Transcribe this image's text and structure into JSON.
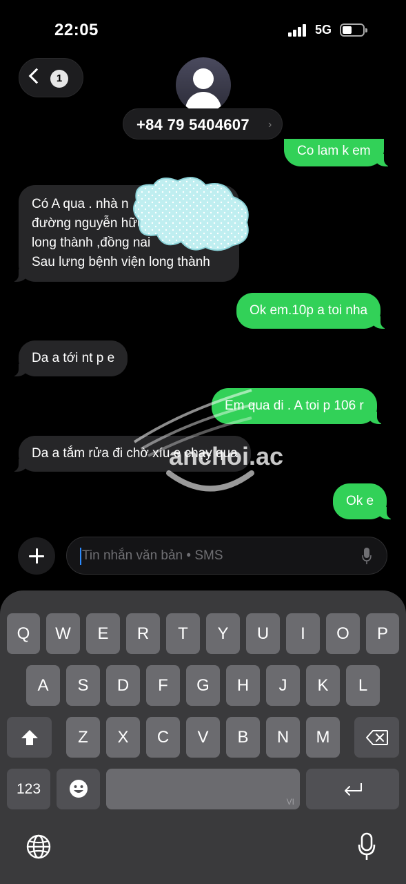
{
  "status_bar": {
    "time": "22:05",
    "network": "5G",
    "icons": [
      "signal-icon",
      "battery-icon"
    ]
  },
  "header": {
    "back_badge": "1",
    "contact": "+84 79 5404607",
    "icons": [
      "chevron-left-icon",
      "avatar-icon",
      "chevron-right-icon"
    ]
  },
  "messages": [
    {
      "direction": "out",
      "text": "Co lam k em"
    },
    {
      "direction": "in",
      "text": "Có A qua . nhà n\nđường nguyễn hữu\nlong thành ,đồng nai\nSau lưng bệnh viện long thành"
    },
    {
      "direction": "out",
      "text": "Ok em.10p a toi nha"
    },
    {
      "direction": "in",
      "text": "Da a tới nt p e"
    },
    {
      "direction": "out",
      "text": "Em qua di . A toi p 106 r"
    },
    {
      "direction": "in",
      "text": "Da a tắm rửa đi chờ xíu e chạy qua"
    },
    {
      "direction": "out",
      "text": "Ok e"
    }
  ],
  "watermark": "anchoi.ac",
  "composer": {
    "placeholder": "Tin nhắn văn bản • SMS",
    "icons": [
      "plus-icon",
      "microphone-icon"
    ]
  },
  "keyboard": {
    "row1": [
      "Q",
      "W",
      "E",
      "R",
      "T",
      "Y",
      "U",
      "I",
      "O",
      "P"
    ],
    "row2": [
      "A",
      "S",
      "D",
      "F",
      "G",
      "H",
      "J",
      "K",
      "L"
    ],
    "row3": [
      "Z",
      "X",
      "C",
      "V",
      "B",
      "N",
      "M"
    ],
    "numbers_label": "123",
    "space_hint": "VI",
    "icons": [
      "shift-icon",
      "backspace-icon",
      "emoji-icon",
      "return-icon",
      "globe-icon",
      "microphone-icon"
    ]
  },
  "colors": {
    "outgoing_bubble": "#32d158",
    "incoming_bubble": "#262628",
    "keyboard_bg": "#3a3a3c",
    "key": "#6b6b6f",
    "caret": "#2d8cff"
  }
}
